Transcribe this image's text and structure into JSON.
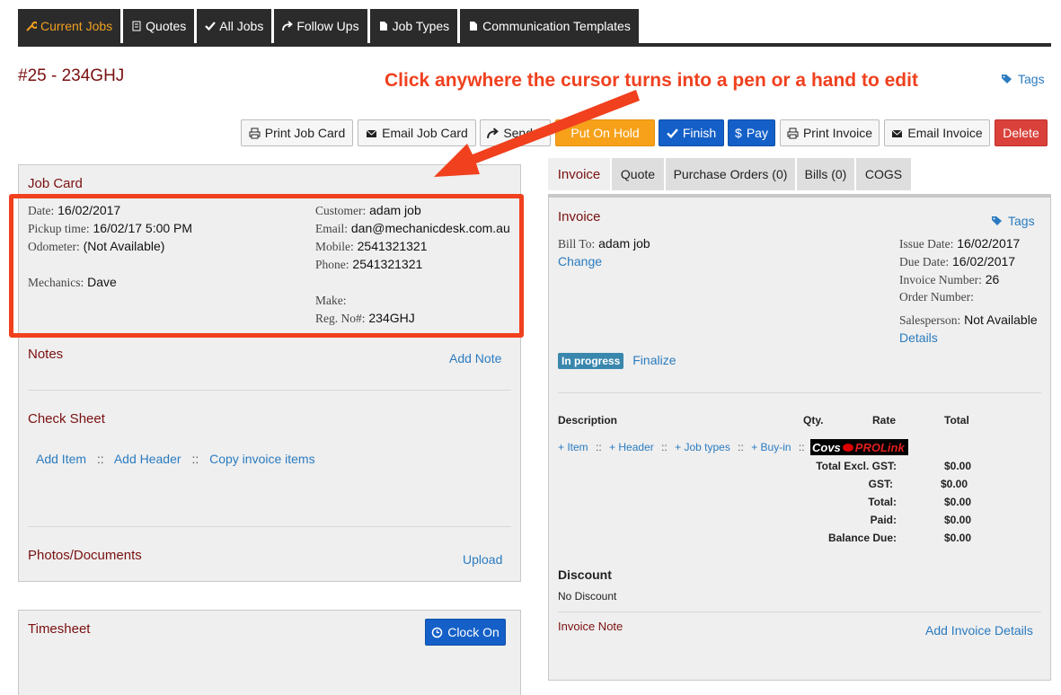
{
  "nav": {
    "tabs": [
      {
        "label": "Current Jobs",
        "icon": "wrench-icon",
        "active": true
      },
      {
        "label": "Quotes",
        "icon": "document-icon"
      },
      {
        "label": "All Jobs",
        "icon": "check-icon"
      },
      {
        "label": "Follow Ups",
        "icon": "share-arrow-icon"
      },
      {
        "label": "Job Types",
        "icon": "file-icon"
      },
      {
        "label": "Communication Templates",
        "icon": "file-icon"
      }
    ]
  },
  "job": {
    "title": "#25 - 234GHJ"
  },
  "annotation": {
    "text": "Click anywhere the cursor turns into a pen or a hand to edit"
  },
  "tags_label": "Tags",
  "actions": {
    "print_job_card": "Print Job Card",
    "email_job_card": "Email Job Card",
    "send": "Send...",
    "put_on_hold": "Put On Hold",
    "finish": "Finish",
    "pay": "Pay",
    "print_invoice": "Print Invoice",
    "email_invoice": "Email Invoice",
    "delete": "Delete"
  },
  "job_card": {
    "title": "Job Card",
    "date_label": "Date:",
    "date": "16/02/2017",
    "pickup_label": "Pickup time:",
    "pickup": "16/02/17 5:00 PM",
    "odometer_label": "Odometer:",
    "odometer": "(Not Available)",
    "mechanics_label": "Mechanics:",
    "mechanics": "Dave",
    "customer_label": "Customer:",
    "customer": "adam job",
    "email_label": "Email:",
    "email": "dan@mechanicdesk.com.au",
    "mobile_label": "Mobile:",
    "mobile": "2541321321",
    "phone_label": "Phone:",
    "phone": "2541321321",
    "make_label": "Make:",
    "rego_label": "Reg. No#:",
    "rego": "234GHJ"
  },
  "notes": {
    "title": "Notes",
    "add": "Add Note"
  },
  "check_sheet": {
    "title": "Check Sheet",
    "add_item": "Add Item",
    "sep": "::",
    "add_header": "Add Header",
    "copy": "Copy invoice items"
  },
  "photos": {
    "title": "Photos/Documents",
    "upload": "Upload"
  },
  "timesheet": {
    "title": "Timesheet",
    "clock_on": "Clock On"
  },
  "right_tabs": [
    "Invoice",
    "Quote",
    "Purchase Orders (0)",
    "Bills (0)",
    "COGS"
  ],
  "invoice": {
    "title": "Invoice",
    "tags": "Tags",
    "bill_to_label": "Bill To:",
    "bill_to": "adam job",
    "change": "Change",
    "issue_label": "Issue Date:",
    "issue": "16/02/2017",
    "due_label": "Due Date:",
    "due": "16/02/2017",
    "number_label": "Invoice Number:",
    "number": "26",
    "order_label": "Order Number:",
    "sales_label": "Salesperson:",
    "sales": "Not Available",
    "details": "Details",
    "status": "In progress",
    "finalize": "Finalize",
    "col_desc": "Description",
    "col_qty": "Qty.",
    "col_rate": "Rate",
    "col_total": "Total",
    "add_item": "+ Item",
    "add_header": "+ Header",
    "add_job_types": "+ Job types",
    "add_buyin": "+ Buy-in",
    "sep": "::",
    "covs": "Covs",
    "prolink": "PROLink",
    "totals": [
      {
        "label": "Total Excl. GST:",
        "value": "$0.00"
      },
      {
        "label": "GST:",
        "value": "$0.00"
      },
      {
        "label": "Total:",
        "value": "$0.00"
      },
      {
        "label": "Paid:",
        "value": "$0.00"
      },
      {
        "label": "Balance Due:",
        "value": "$0.00"
      }
    ],
    "discount_title": "Discount",
    "discount_value": "No Discount",
    "note_label": "Invoice Note",
    "add_details": "Add Invoice Details"
  },
  "colors": {
    "accent_red": "#f0401e",
    "nav_bg": "#2b2b2b",
    "link": "#2a7bc0",
    "title": "#7a1010"
  }
}
